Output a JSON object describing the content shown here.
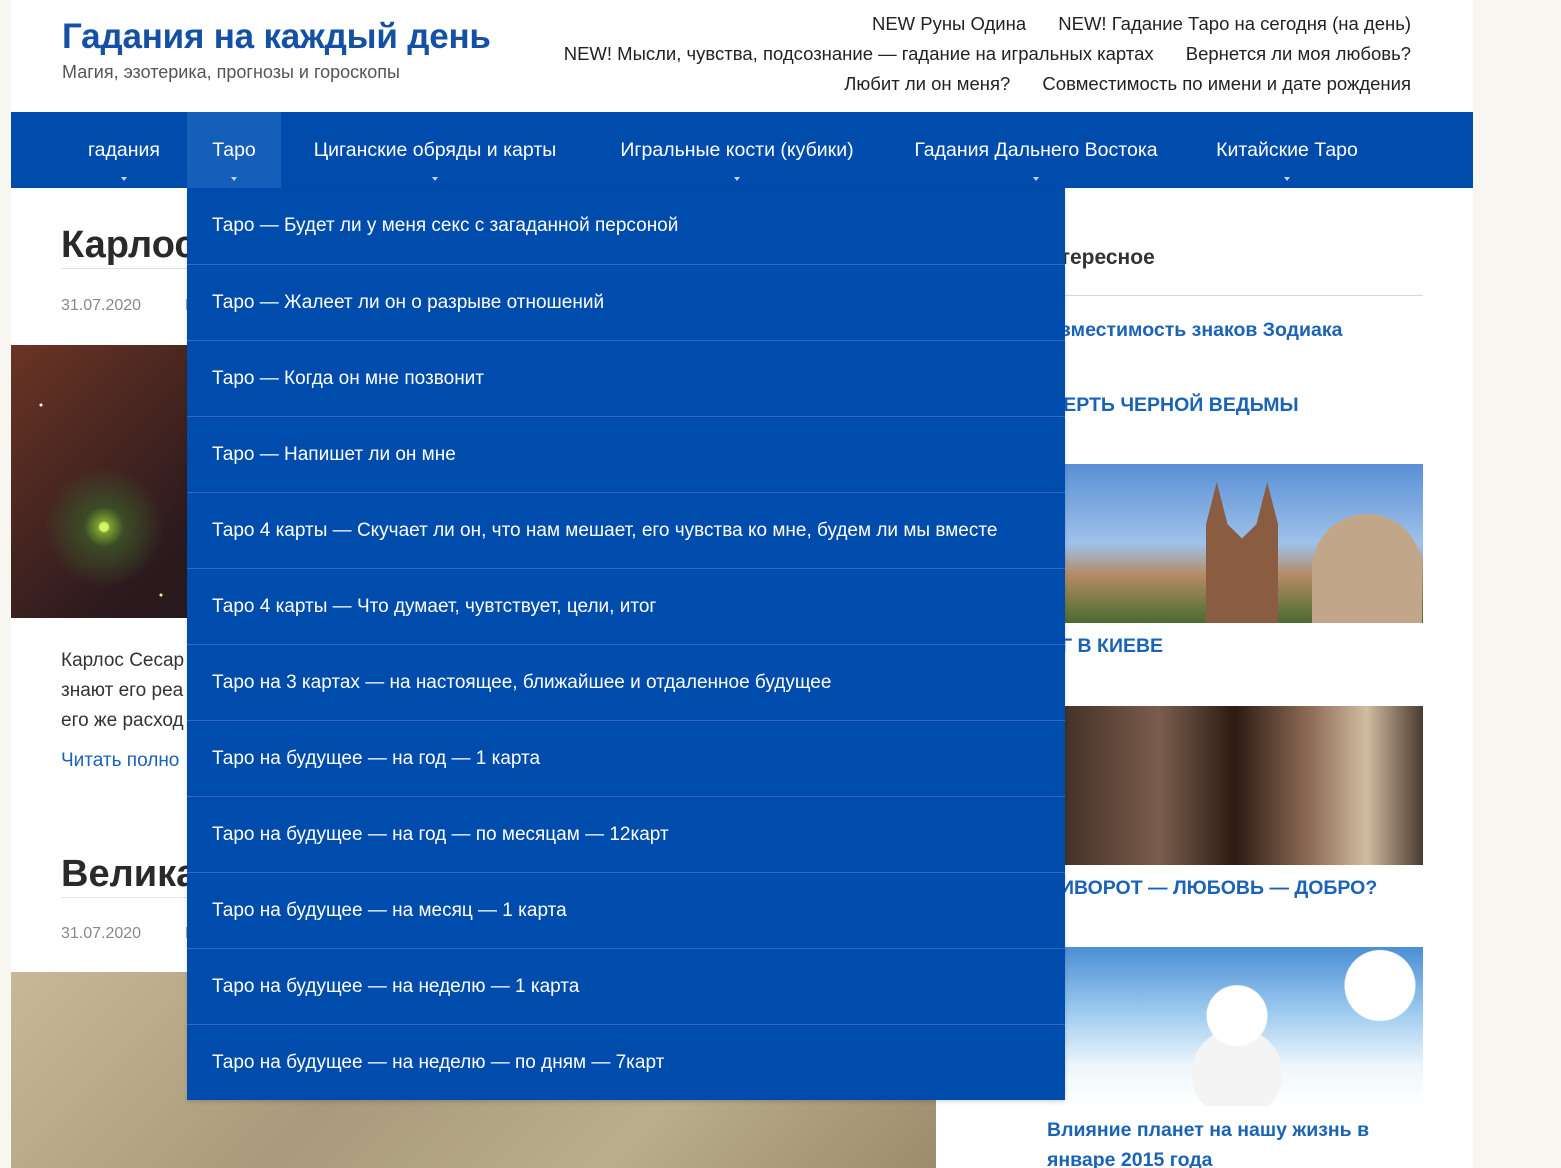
{
  "site": {
    "title": "Гадания на каждый день",
    "description": "Магия, эзотерика, прогнозы и гороскопы"
  },
  "top_links": {
    "row1": [
      "NEW Руны Одина",
      "NEW! Гадание Таро на сегодня (на день)"
    ],
    "row2": [
      "NEW! Мысли, чувства, подсознание — гадание на игральных картах",
      "Вернется ли моя любовь?"
    ],
    "row3": [
      "Любит ли он меня?",
      "Совместимость по имени и дате рождения"
    ]
  },
  "nav": {
    "items": [
      {
        "label": "гадания"
      },
      {
        "label": "Таро"
      },
      {
        "label": "Циганские обряды и карты"
      },
      {
        "label": "Игральные кости (кубики)"
      },
      {
        "label": "Гадания Дальнего Востока"
      },
      {
        "label": "Китайские Таро"
      }
    ],
    "active": "Таро"
  },
  "dropdown": {
    "items": [
      "Таро — Будет ли у меня секс с загаданной персоной",
      "Таро — Жалеет ли он о разрыве отношений",
      "Таро — Когда он мне позвонит",
      "Таро — Напишет ли он мне",
      "Таро 4 карты — Скучает ли он, что нам мешает, его чувства ко мне, будем ли мы вместе",
      "Таро 4 карты — Что думает, чувтствует, цели, итог",
      "Таро на 3 картах — на настоящее, ближайшее и отдаленное будущее",
      "Таро на будущее — на год — 1 карта",
      "Таро на будущее — на год — по месяцам — 12карт",
      "Таро на будущее — на месяц — 1 карта",
      "Таро на будущее — на неделю — 1 карта",
      "Таро на будущее — на неделю — по дням — 7карт"
    ]
  },
  "posts": [
    {
      "title": "Карлос",
      "date": "31.07.2020",
      "meta": "Р",
      "excerpt": [
        "Карлос Сесар",
        "знают его реа",
        "его же расход"
      ],
      "read_more": "Читать полно"
    },
    {
      "title": "Велика",
      "date": "31.07.2020",
      "meta": "Р"
    }
  ],
  "sidebar": {
    "title": "нтересное",
    "links": [
      "овместимость знаков Зодиака",
      "МЕРТЬ ЧЕРНОЙ ВЕДЬМЫ",
      "АГ В КИЕВЕ",
      "РИВОРОТ — ЛЮБОВЬ — ДОБРО?",
      "Влияние планет на нашу жизнь в январе 2015 года"
    ]
  }
}
